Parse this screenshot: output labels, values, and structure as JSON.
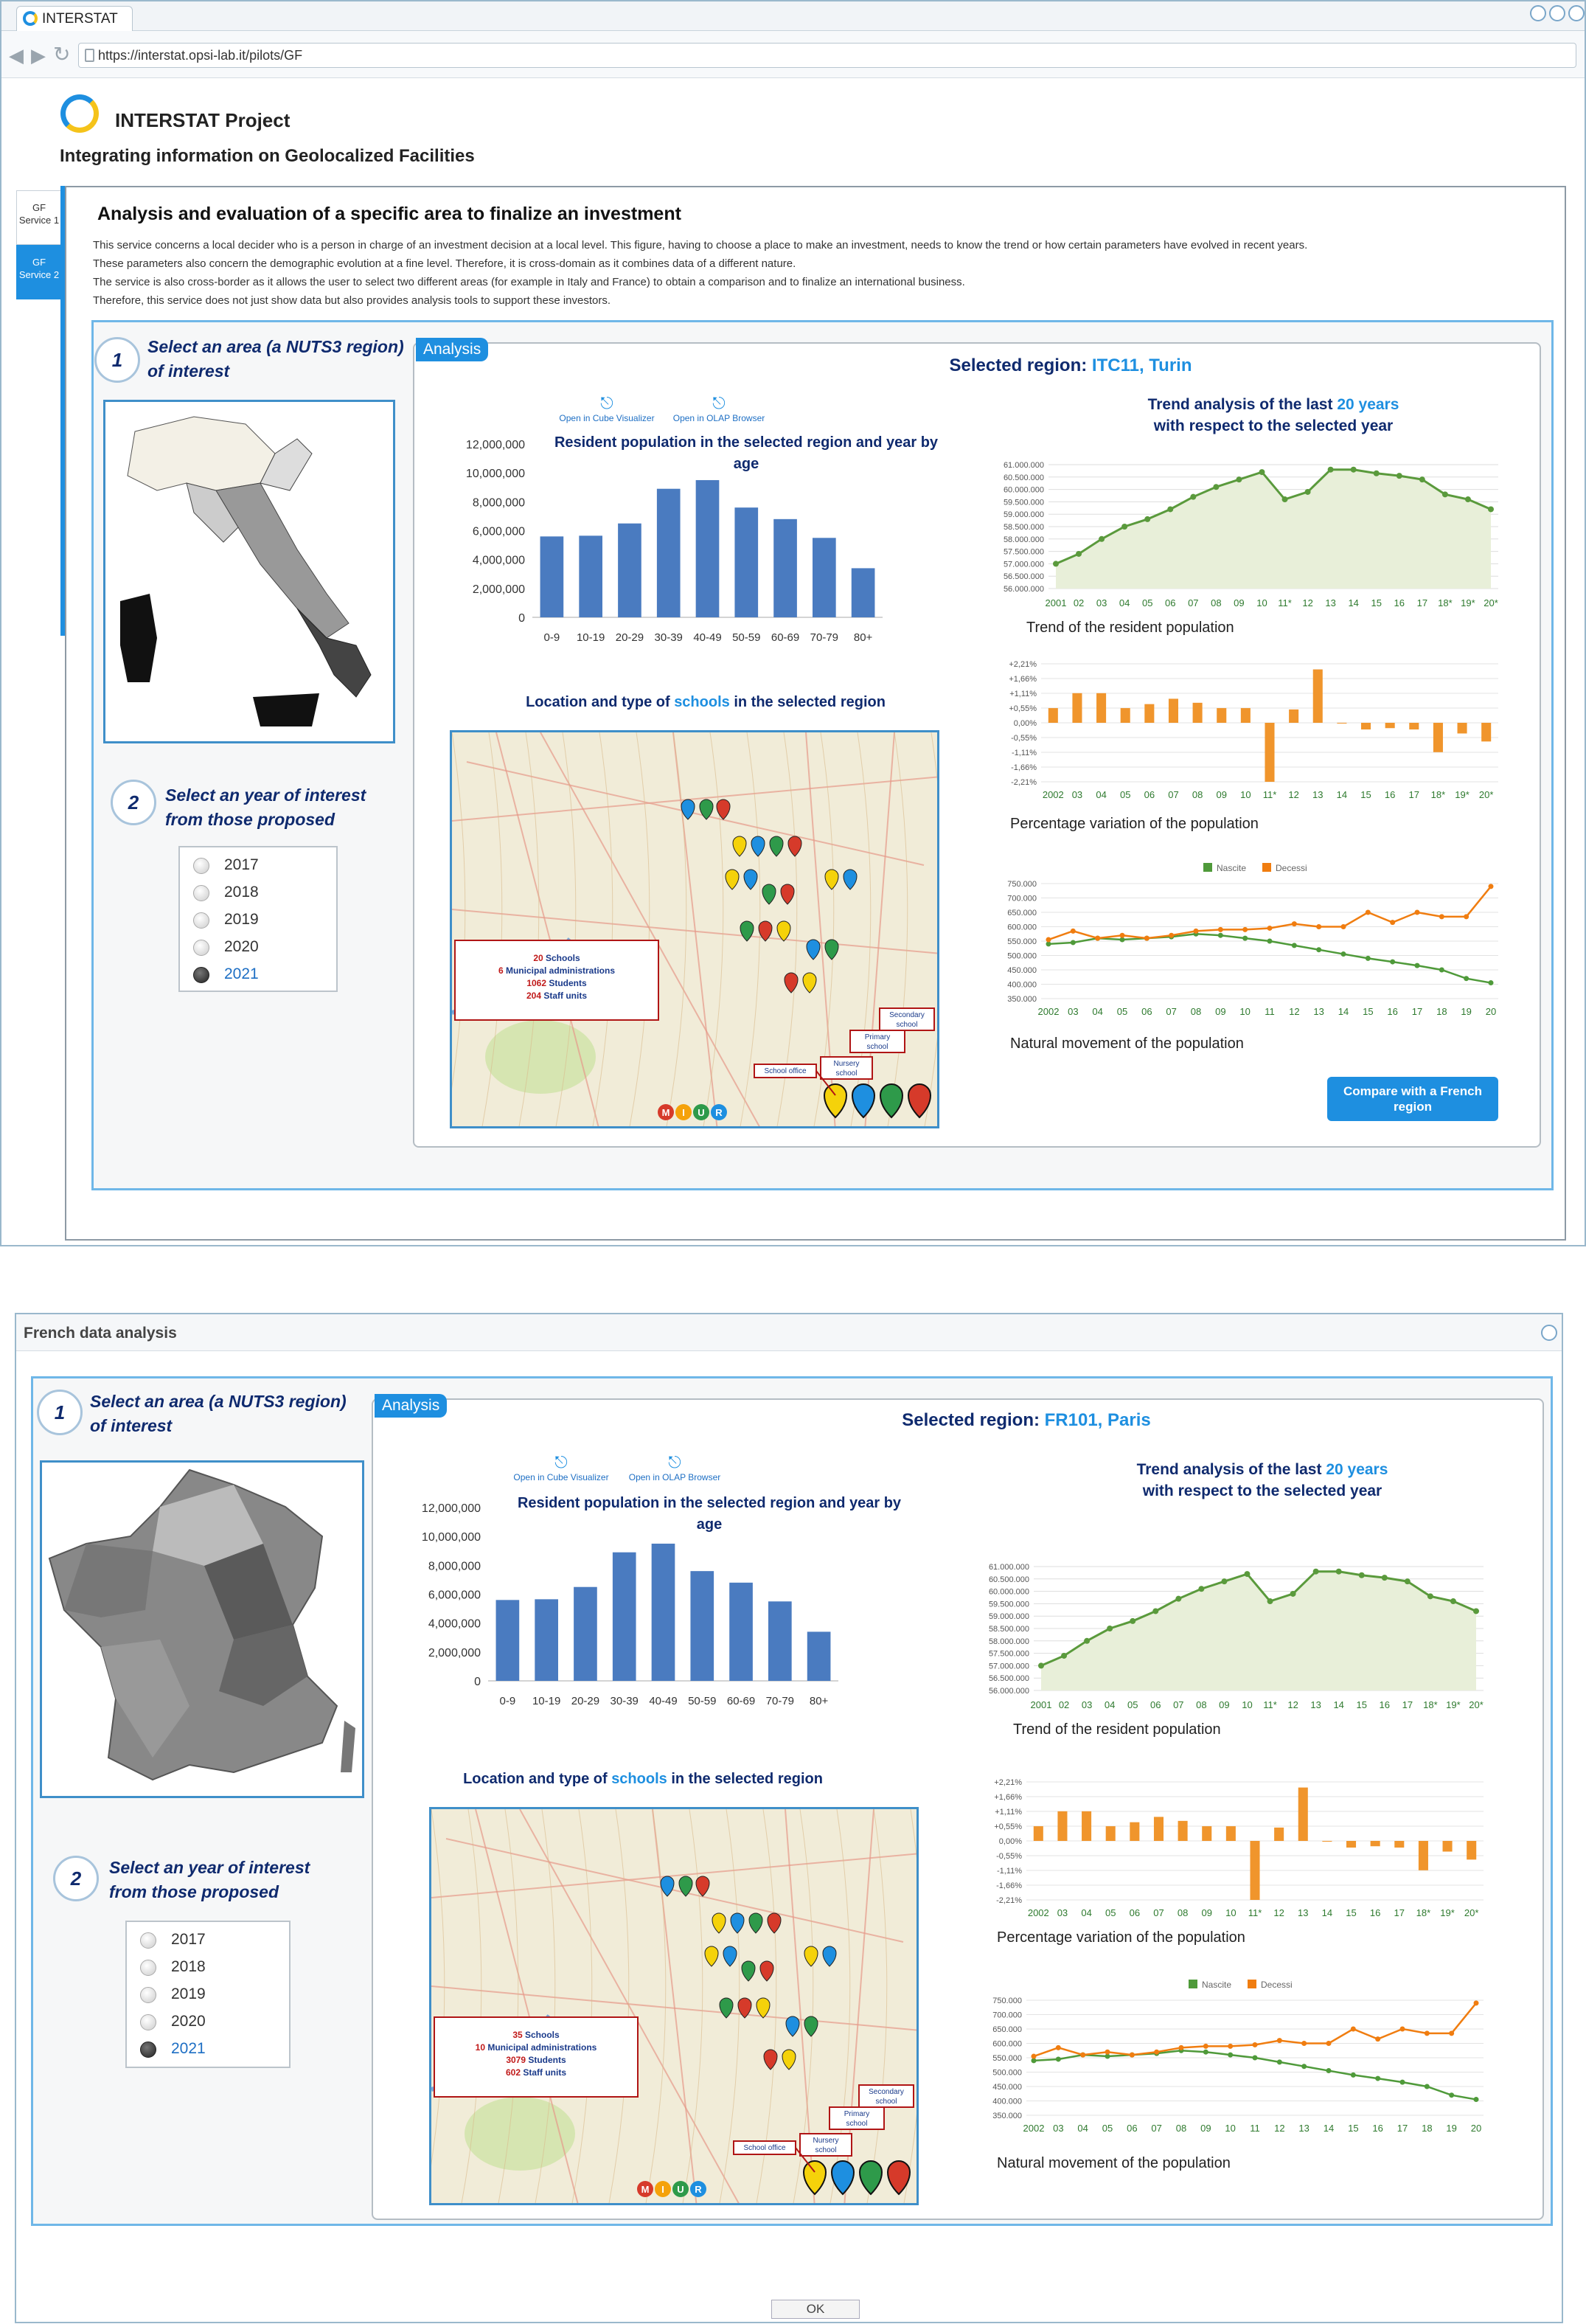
{
  "browser": {
    "tab_title": "INTERSTAT",
    "url": "https://interstat.opsi-lab.it/pilots/GF"
  },
  "header": {
    "project": "INTERSTAT Project",
    "subtitle": "Integrating information on Geolocalized Facilities"
  },
  "sidebar": {
    "tabs": [
      {
        "label": "GF Service 1"
      },
      {
        "label": "GF Service 2"
      }
    ]
  },
  "service": {
    "title": "Analysis and evaluation of a specific area to finalize an investment",
    "desc": [
      "This service concerns a local decider who is a person in charge of an investment decision at a local level. This figure, having to choose a place to make an investment, needs to know the trend or how certain parameters have evolved in recent years.",
      "These parameters also concern the demographic evolution at a fine level. Therefore, it is cross-domain as it combines data of a different nature.",
      "The service is also cross-border as it allows the user to select two different areas (for example in Italy and France) to obtain a comparison and to finalize an international business.",
      "Therefore, this service does not just show data but also provides analysis tools to support these investors."
    ]
  },
  "common": {
    "step1": "Select an area (a NUTS3 region) of interest",
    "step2": "Select an year of interest from those proposed",
    "years": [
      "2017",
      "2018",
      "2019",
      "2020",
      "2021"
    ],
    "selected_year": "2021",
    "analysis": "Analysis",
    "selected_region_prefix": "Selected region:",
    "pop_title": "Resident population in the selected region and year by age",
    "open_cube": "Open in Cube Visualizer",
    "open_olap": "Open in OLAP Browser",
    "map_title_pre": "Location and type of",
    "map_title_hl": "schools",
    "map_title_post": "in the selected region",
    "trend_title_pre": "Trend analysis of the last",
    "trend_title_hl": "20 years",
    "trend_title_post": "with respect to the selected year",
    "cap_trend": "Trend of the resident population",
    "cap_pct": "Percentage variation of the population",
    "cap_nat": "Natural movement of the population",
    "legend_births": "Nascite",
    "legend_deaths": "Decessi",
    "map_labels": {
      "secondary": "Secondary school",
      "primary": "Primary school",
      "nursery": "Nursery school",
      "office": "School office"
    },
    "info_schools": "Schools",
    "info_admin": "Municipal administrations",
    "info_students": "Students",
    "info_staff": "Staff units",
    "map_logo": "MIUR"
  },
  "italy": {
    "region": "ITC11, Turin",
    "schools": "20",
    "admin": "6",
    "students": "1062",
    "staff": "204",
    "compare_button": "Compare with a French region"
  },
  "france": {
    "window_title": "French data analysis",
    "region": "FR101, Paris",
    "schools": "35",
    "admin": "10",
    "students": "3079",
    "staff": "602",
    "ok_button": "OK"
  },
  "chart_data": [
    {
      "type": "bar",
      "title": "Resident population in the selected region and year by age",
      "categories": [
        "0-9",
        "10-19",
        "20-29",
        "30-39",
        "40-49",
        "50-59",
        "60-69",
        "70-79",
        "80+"
      ],
      "values": [
        5600000,
        5650000,
        6500000,
        8900000,
        9500000,
        7600000,
        6800000,
        5500000,
        3400000
      ],
      "yticks": [
        "12,000,000",
        "10,000,000",
        "8,000,000",
        "6,000,000",
        "4,000,000",
        "2,000,000",
        "0"
      ],
      "ylim": [
        0,
        12000000
      ],
      "color": "#4a7bc0"
    },
    {
      "type": "area",
      "title": "Trend of the resident population",
      "x": [
        "2001",
        "02",
        "03",
        "04",
        "05",
        "06",
        "07",
        "08",
        "09",
        "10",
        "11*",
        "12",
        "13",
        "14",
        "15",
        "16",
        "17",
        "18*",
        "19*",
        "20*"
      ],
      "values": [
        57000000,
        57400000,
        58000000,
        58500000,
        58800000,
        59200000,
        59700000,
        60100000,
        60400000,
        60700000,
        59600000,
        59900000,
        60800000,
        60800000,
        60650000,
        60550000,
        60400000,
        59800000,
        59600000,
        59200000
      ],
      "yticks": [
        "61.000.000",
        "60.500.000",
        "60.000.000",
        "59.500.000",
        "59.000.000",
        "58.500.000",
        "58.000.000",
        "57.500.000",
        "57.000.000",
        "56.500.000",
        "56.000.000"
      ],
      "ylim": [
        56000000,
        61000000
      ],
      "color": "#5a9a3c",
      "fill": "#e8efd9"
    },
    {
      "type": "bar",
      "title": "Percentage variation of the population",
      "x": [
        "2002",
        "03",
        "04",
        "05",
        "06",
        "07",
        "08",
        "09",
        "10",
        "11*",
        "12",
        "13",
        "14",
        "15",
        "16",
        "17",
        "18*",
        "19*",
        "20*"
      ],
      "values": [
        0.55,
        1.11,
        1.11,
        0.55,
        0.7,
        0.9,
        0.75,
        0.55,
        0.55,
        -2.21,
        0.5,
        2.0,
        0.0,
        -0.25,
        -0.2,
        -0.25,
        -1.1,
        -0.4,
        -0.7
      ],
      "yticks": [
        "+2,21%",
        "+1,66%",
        "+1,11%",
        "+0,55%",
        "0,00%",
        "-0,55%",
        "-1,11%",
        "-1,66%",
        "-2,21%"
      ],
      "ylim": [
        -2.21,
        2.21
      ],
      "color": "#f0952c"
    },
    {
      "type": "line",
      "title": "Natural movement of the population",
      "x": [
        "2002",
        "03",
        "04",
        "05",
        "06",
        "07",
        "08",
        "09",
        "10",
        "11",
        "12",
        "13",
        "14",
        "15",
        "16",
        "17",
        "18",
        "19",
        "20"
      ],
      "series": [
        {
          "name": "Nascite",
          "color": "#4f9a3a",
          "values": [
            540000,
            545000,
            560000,
            555000,
            560000,
            565000,
            575000,
            570000,
            560000,
            550000,
            535000,
            520000,
            505000,
            490000,
            478000,
            465000,
            450000,
            420000,
            405000
          ]
        },
        {
          "name": "Decessi",
          "color": "#f07d10",
          "values": [
            555000,
            585000,
            560000,
            570000,
            560000,
            570000,
            585000,
            590000,
            590000,
            595000,
            610000,
            600000,
            600000,
            650000,
            615000,
            650000,
            635000,
            635000,
            740000
          ]
        }
      ],
      "yticks": [
        "750.000",
        "700.000",
        "650.000",
        "600.000",
        "550.000",
        "500.000",
        "450.000",
        "400.000",
        "350.000"
      ],
      "ylim": [
        350000,
        750000
      ]
    }
  ]
}
